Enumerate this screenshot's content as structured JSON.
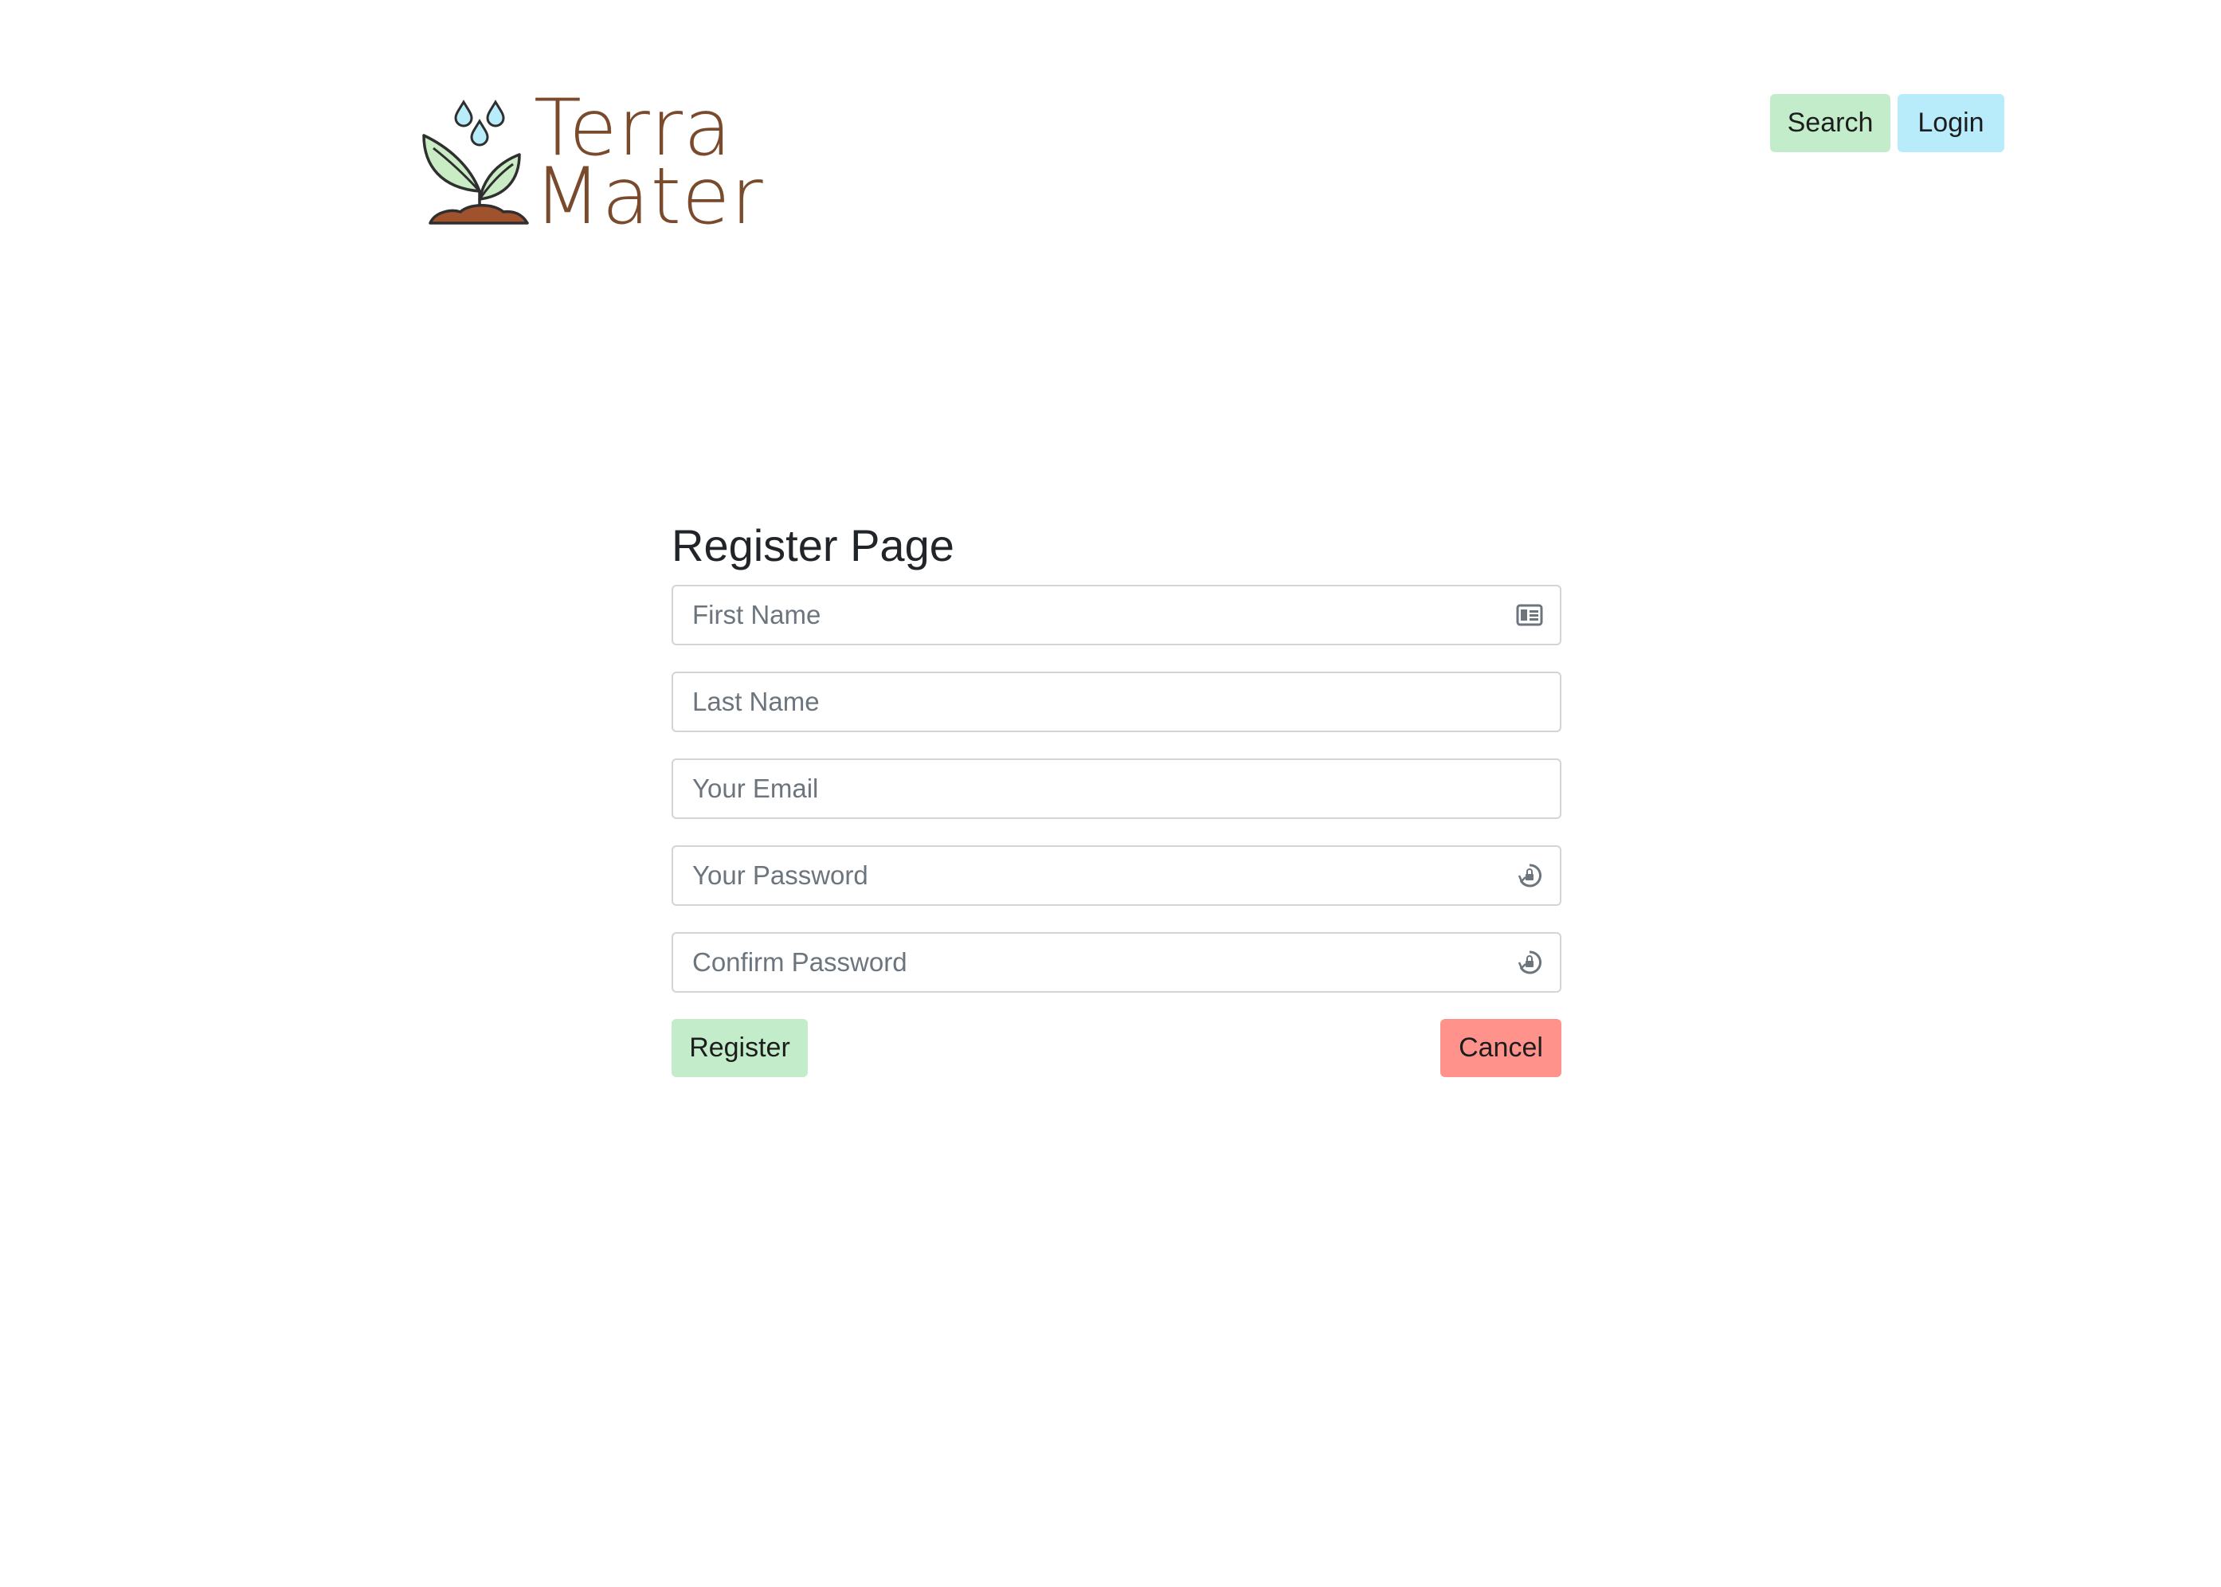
{
  "header": {
    "logo": {
      "line1": "Terra",
      "line2": "Mater",
      "icon": "sprout-with-water-drops-icon"
    },
    "nav": {
      "search_label": "Search",
      "login_label": "Login"
    }
  },
  "form": {
    "title": "Register Page",
    "fields": [
      {
        "placeholder": "First Name",
        "value": "",
        "icon": "id-card-icon"
      },
      {
        "placeholder": "Last Name",
        "value": ""
      },
      {
        "placeholder": "Your Email",
        "value": ""
      },
      {
        "placeholder": "Your Password",
        "value": "",
        "icon": "password-lock-icon"
      },
      {
        "placeholder": "Confirm Password",
        "value": "",
        "icon": "password-lock-icon"
      }
    ],
    "register_label": "Register",
    "cancel_label": "Cancel"
  },
  "colors": {
    "search_button": "#c3ecca",
    "login_button": "#b8ecfb",
    "register_button": "#c3ecca",
    "cancel_button": "#ff938c",
    "logo_text": "#7a4a2c",
    "leaf": "#c9ecc5",
    "soil": "#a0522d",
    "water": "#b8ecfb"
  }
}
